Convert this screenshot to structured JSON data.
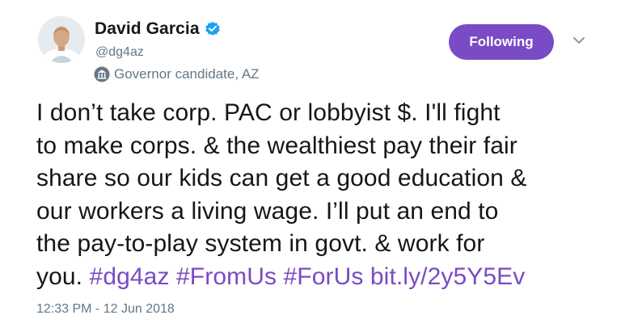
{
  "author": {
    "display_name": "David Garcia",
    "handle": "@dg4az",
    "verified": true,
    "label": "Governor candidate, AZ",
    "label_icon": "government-building-icon"
  },
  "follow_button": {
    "label": "Following",
    "color": "#794bc4"
  },
  "tweet": {
    "lines": [
      "I don’t take corp. PAC or lobbyist $. I'll fight",
      "to make corps. & the wealthiest pay their fair",
      "share so our kids can get a good education &",
      "our workers a living wage. I’ll put an end to",
      "the pay-to-play system in govt. & work for"
    ],
    "last_line_text": "you.",
    "hashtags": [
      "#dg4az",
      "#FromUs",
      "#ForUs"
    ],
    "link": "bit.ly/2y5Y5Ev",
    "link_color": "#794bc4"
  },
  "timestamp": "12:33 PM - 12 Jun 2018",
  "colors": {
    "text": "#14171a",
    "secondary": "#657786",
    "verified": "#1da1f2"
  }
}
